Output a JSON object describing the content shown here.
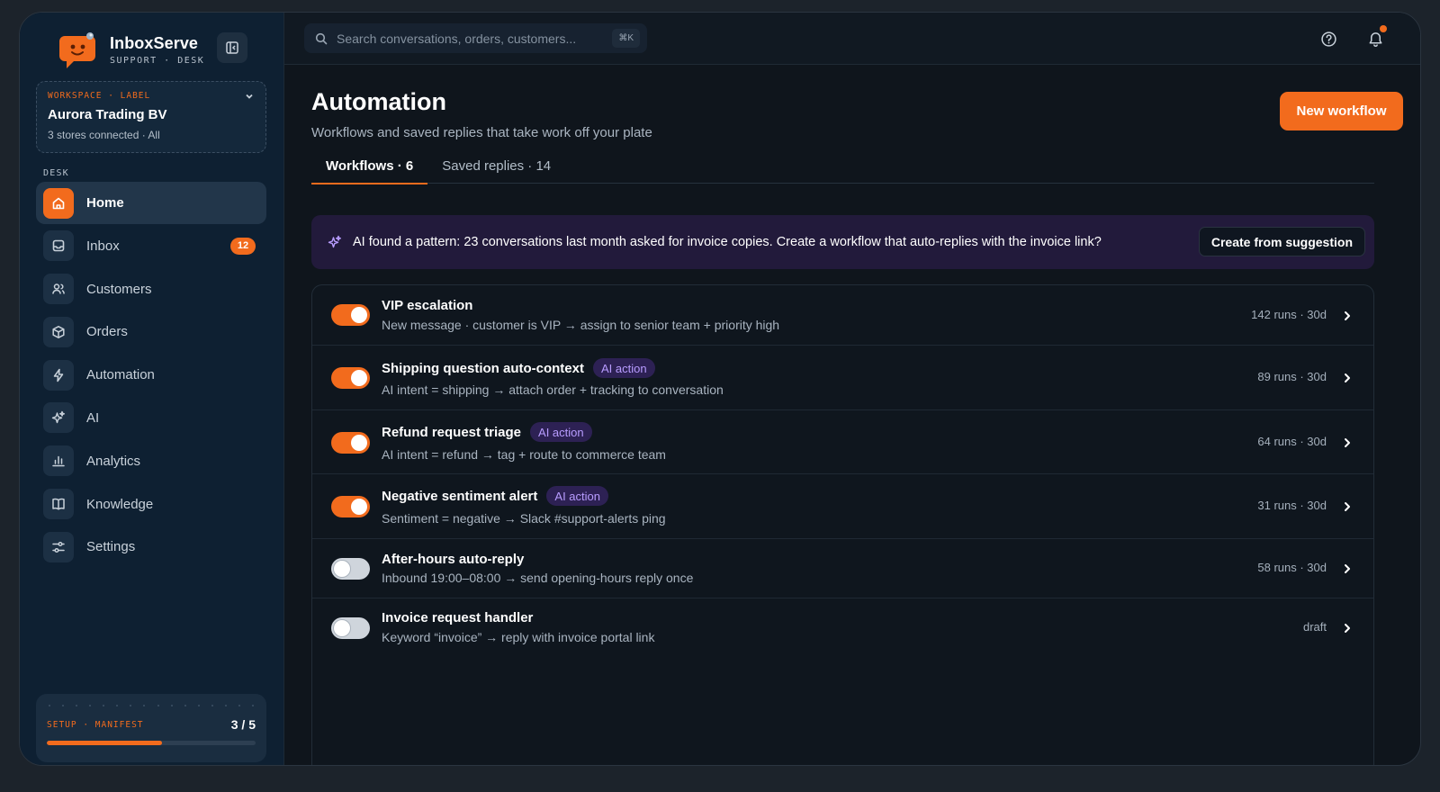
{
  "brand": {
    "name": "InboxServe",
    "sub": "SUPPORT · DESK"
  },
  "workspace": {
    "label": "WORKSPACE · LABEL",
    "name": "Aurora Trading BV",
    "meta": "3 stores connected · All"
  },
  "nav": {
    "section_label": "DESK",
    "items": [
      {
        "label": "Home",
        "icon": "home-icon",
        "active": true
      },
      {
        "label": "Inbox",
        "icon": "inbox-icon",
        "badge": "12"
      },
      {
        "label": "Customers",
        "icon": "users-icon"
      },
      {
        "label": "Orders",
        "icon": "box-icon"
      },
      {
        "label": "Automation",
        "icon": "bolt-icon"
      },
      {
        "label": "AI",
        "icon": "sparkle-icon"
      },
      {
        "label": "Analytics",
        "icon": "bar-chart-icon"
      },
      {
        "label": "Knowledge",
        "icon": "book-icon"
      },
      {
        "label": "Settings",
        "icon": "sliders-icon"
      }
    ]
  },
  "setup": {
    "label": "SETUP · MANIFEST",
    "count": "3 / 5",
    "progress": 0.55
  },
  "search": {
    "placeholder": "Search conversations, orders, customers...",
    "shortcut": "⌘K"
  },
  "page": {
    "title": "Automation",
    "subtitle": "Workflows and saved replies that take work off your plate",
    "primary_button": "New workflow"
  },
  "tabs": [
    {
      "label": "Workflows · 6",
      "active": true
    },
    {
      "label": "Saved replies · 14",
      "active": false
    }
  ],
  "banner": {
    "text": "AI found a pattern: 23 conversations last month asked for invoice copies. Create a workflow that auto-replies with the invoice link?",
    "button": "Create from suggestion"
  },
  "workflows": [
    {
      "title": "VIP escalation",
      "desc": "New message · customer is VIP → assign to senior team + priority high",
      "meta": "142 runs · 30d",
      "enabled": true,
      "ai_badge": ""
    },
    {
      "title": "Shipping question auto-context",
      "desc": "AI intent = shipping → attach order + tracking to conversation",
      "meta": "89 runs · 30d",
      "enabled": true,
      "ai_badge": "AI action"
    },
    {
      "title": "Refund request triage",
      "desc": "AI intent = refund → tag + route to commerce team",
      "meta": "64 runs · 30d",
      "enabled": true,
      "ai_badge": "AI action"
    },
    {
      "title": "Negative sentiment alert",
      "desc": "Sentiment = negative → Slack #support-alerts ping",
      "meta": "31 runs · 30d",
      "enabled": true,
      "ai_badge": "AI action"
    },
    {
      "title": "After-hours auto-reply",
      "desc": "Inbound 19:00–08:00 → send opening-hours reply once",
      "meta": "58 runs · 30d",
      "enabled": false,
      "ai_badge": ""
    },
    {
      "title": "Invoice request handler",
      "desc": "Keyword “invoice” → reply with invoice portal link",
      "meta": "draft",
      "enabled": false,
      "ai_badge": ""
    }
  ],
  "colors": {
    "accent": "#f26b1d",
    "sidebar": "#0e2032",
    "ai_purple": "#b89cff",
    "banner_bg": "#221a3b"
  }
}
